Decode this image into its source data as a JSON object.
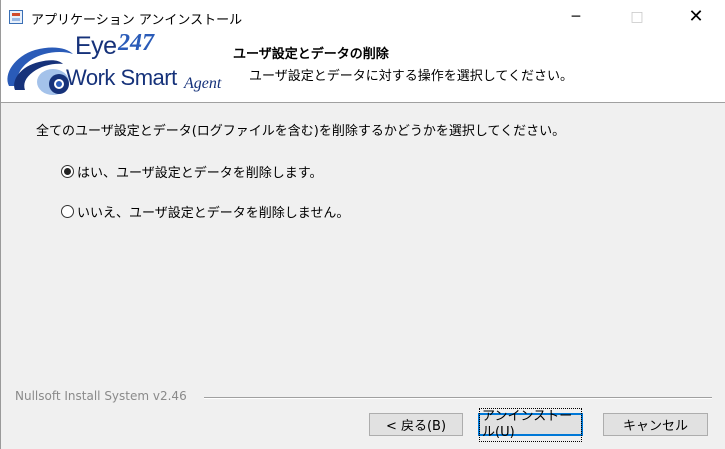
{
  "window": {
    "title": "アプリケーション アンインストール",
    "controls": {
      "minimize": "─",
      "maximize": "□",
      "close": "✕"
    }
  },
  "header": {
    "logo": {
      "line1": "Eye",
      "line1_num": "247",
      "line2": "Work Smart",
      "line2_suffix": "Agent"
    },
    "title": "ユーザ設定とデータの削除",
    "subtitle": "ユーザ設定とデータに対する操作を選択してください。"
  },
  "content": {
    "instruction": "全てのユーザ設定とデータ(ログファイルを含む)を削除するかどうかを選択してください。",
    "options": [
      {
        "label": "はい、ユーザ設定とデータを削除します。",
        "checked": true
      },
      {
        "label": "いいえ、ユーザ設定とデータを削除しません。",
        "checked": false
      }
    ]
  },
  "footer": {
    "branding": "Nullsoft Install System v2.46",
    "buttons": {
      "back": "< 戻る(B)",
      "uninstall": "アンインストール(U)",
      "cancel": "キャンセル"
    }
  },
  "colors": {
    "accent": "#0078d7",
    "logo_blue": "#16327a",
    "logo_light_blue": "#2a5bb8"
  }
}
